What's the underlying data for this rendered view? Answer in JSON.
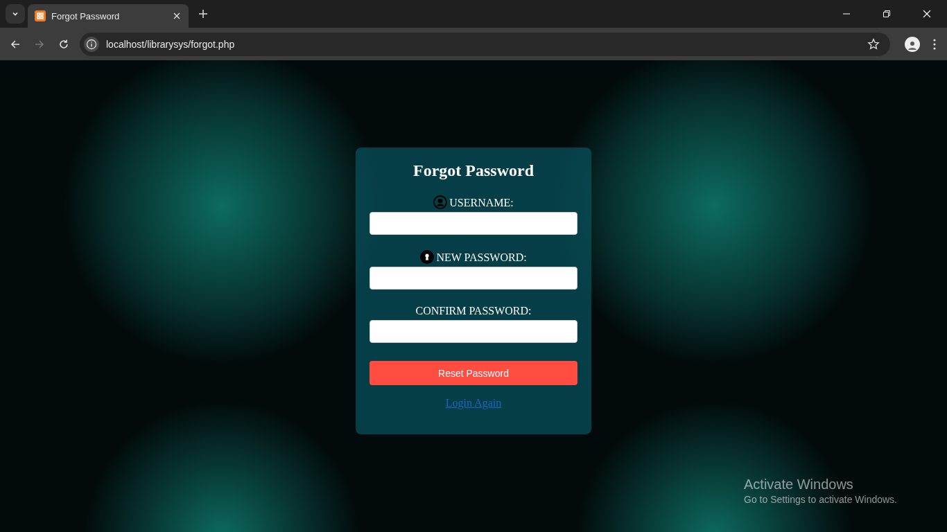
{
  "browser": {
    "tab_title": "Forgot Password",
    "url": "localhost/librarysys/forgot.php"
  },
  "form": {
    "title": "Forgot Password",
    "fields": [
      {
        "label": "USERNAME:",
        "kind": "username"
      },
      {
        "label": "NEW PASSWORD:",
        "kind": "password"
      },
      {
        "label": "CONFIRM PASSWORD:",
        "kind": "confirm"
      }
    ],
    "button": "Reset Password",
    "link": "Login Again"
  },
  "os_notice": {
    "title": "Activate Windows",
    "text": "Go to Settings to activate Windows."
  }
}
